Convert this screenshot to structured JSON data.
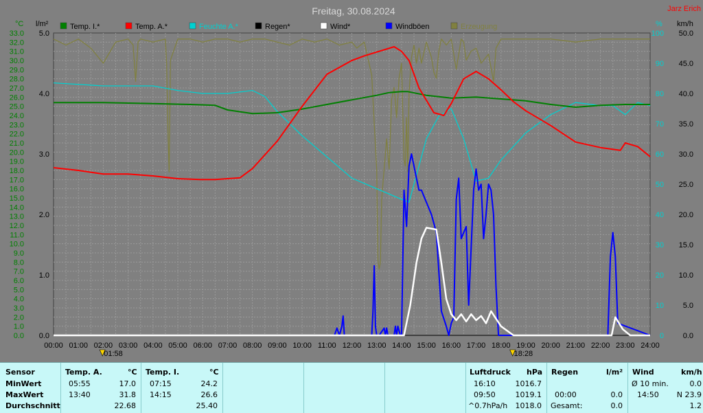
{
  "title": "Freitag, 30.08.2024",
  "author": "Jarz Erich",
  "axes": {
    "left1_unit": "°C",
    "left2_unit": "l/m²",
    "right1_unit": "%",
    "right2_unit": "km/h"
  },
  "markers": {
    "sunrise": "01:58",
    "sunset": "18:28"
  },
  "colors": {
    "temp_i": "#008000",
    "temp_a": "#ff0000",
    "feuchte": "#00d0d0",
    "regen": "#000000",
    "wind": "#ffffff",
    "windboeen": "#0000ff",
    "erzeugung": "#808040",
    "plot_bg": "#808080"
  },
  "chart_data": {
    "type": "line",
    "title": "Freitag, 30.08.2024",
    "xlabel": "",
    "x_ticks": [
      "00:00",
      "01:00",
      "02:00",
      "03:00",
      "04:00",
      "05:00",
      "06:00",
      "07:00",
      "08:00",
      "09:00",
      "10:00",
      "11:00",
      "12:00",
      "13:00",
      "14:00",
      "15:00",
      "16:00",
      "17:00",
      "18:00",
      "19:00",
      "20:00",
      "21:00",
      "22:00",
      "23:00",
      "24:00"
    ],
    "y_left_temp": {
      "label": "°C",
      "range": [
        0,
        33
      ],
      "ticks": [
        "0.0",
        "1.0",
        "2.0",
        "3.0",
        "4.0",
        "5.0",
        "6.0",
        "7.0",
        "8.0",
        "9.0",
        "10.0",
        "11.0",
        "12.0",
        "13.0",
        "14.0",
        "15.0",
        "16.0",
        "17.0",
        "18.0",
        "19.0",
        "20.0",
        "21.0",
        "22.0",
        "23.0",
        "24.0",
        "25.0",
        "26.0",
        "27.0",
        "28.0",
        "29.0",
        "30.0",
        "31.0",
        "32.0",
        "33.0"
      ]
    },
    "y_left_rain": {
      "label": "l/m²",
      "range": [
        0,
        5
      ],
      "ticks": [
        "0.0",
        "1.0",
        "2.0",
        "3.0",
        "4.0",
        "5.0"
      ]
    },
    "y_right_hum": {
      "label": "%",
      "range": [
        0,
        100
      ],
      "ticks": [
        "0",
        "10",
        "20",
        "30",
        "40",
        "50",
        "60",
        "70",
        "80",
        "90",
        "100"
      ]
    },
    "y_right_wind": {
      "label": "km/h",
      "range": [
        0,
        50
      ],
      "ticks": [
        "0.0",
        "5.0",
        "10.0",
        "15.0",
        "20.0",
        "25.0",
        "30.0",
        "35.0",
        "40.0",
        "45.0",
        "50.0"
      ]
    },
    "series": [
      {
        "name": "Temp. I.*",
        "axis": "temp",
        "x": [
          0,
          2,
          4,
          5.5,
          6.5,
          7,
          8,
          9,
          10,
          11,
          12,
          13,
          13.5,
          14,
          14.25,
          15,
          16,
          17,
          18,
          19,
          20,
          21,
          22,
          23,
          24
        ],
        "y": [
          25.4,
          25.4,
          25.3,
          25.2,
          25.1,
          24.6,
          24.2,
          24.3,
          24.7,
          25.2,
          25.7,
          26.2,
          26.5,
          26.6,
          26.6,
          26.2,
          25.9,
          26.0,
          25.8,
          25.6,
          25.2,
          24.9,
          25.1,
          25.2,
          25.2
        ]
      },
      {
        "name": "Temp. A.*",
        "axis": "temp",
        "x": [
          0,
          1,
          2,
          3,
          4,
          5,
          5.9,
          6.5,
          7.5,
          8,
          9,
          10,
          11,
          12,
          12.5,
          13.7,
          14,
          14.3,
          14.7,
          15.3,
          15.7,
          16,
          16.5,
          17,
          17.5,
          18,
          18.5,
          19,
          20,
          21,
          22,
          22.5,
          22.8,
          23,
          23.5,
          24
        ],
        "y": [
          18.3,
          18.0,
          17.6,
          17.6,
          17.4,
          17.1,
          17.0,
          17.0,
          17.2,
          18.2,
          21.2,
          25.0,
          28.5,
          30.0,
          30.5,
          31.5,
          31.0,
          30.0,
          27.0,
          24.3,
          24.0,
          25.3,
          28.0,
          28.8,
          28.0,
          26.8,
          25.5,
          24.5,
          22.9,
          21.1,
          20.5,
          20.3,
          20.2,
          21.0,
          20.6,
          19.5
        ]
      },
      {
        "name": "Feuchte A.*",
        "axis": "hum",
        "x": [
          0,
          2,
          3,
          4,
          5,
          6,
          7,
          8,
          8.5,
          9,
          10,
          11,
          12,
          13,
          14,
          14.3,
          15,
          15.5,
          16,
          16.5,
          17,
          17.5,
          18,
          19,
          20,
          21,
          22,
          22.5,
          23,
          23.5,
          24
        ],
        "y": [
          83.5,
          82.5,
          82.5,
          82.5,
          81,
          80,
          80,
          81,
          79,
          74,
          66,
          59,
          52,
          48.5,
          45,
          44,
          65,
          72.5,
          75,
          65,
          51,
          52,
          58,
          67,
          73,
          77,
          76,
          76,
          73,
          77,
          76
        ]
      },
      {
        "name": "Regen*",
        "axis": "rain",
        "x": [
          0,
          24
        ],
        "y": [
          0,
          0
        ]
      },
      {
        "name": "Wind*",
        "axis": "wind",
        "x": [
          0,
          14.1,
          14.35,
          14.6,
          14.8,
          15,
          15.4,
          15.6,
          15.8,
          16,
          16.2,
          16.4,
          16.6,
          16.8,
          17,
          17.2,
          17.4,
          17.6,
          18,
          18.5,
          22.45,
          22.6,
          22.9,
          23.2,
          24
        ],
        "y": [
          0,
          0,
          5,
          12,
          16,
          17.8,
          17.5,
          12,
          6,
          3.5,
          2.5,
          3.5,
          2.3,
          3.5,
          2.5,
          3.2,
          2,
          4,
          1.5,
          0,
          0,
          3,
          1,
          0,
          0
        ]
      },
      {
        "name": "Windböen",
        "axis": "wind",
        "x": [
          0,
          11.3,
          11.4,
          11.5,
          11.6,
          11.65,
          11.7,
          12.8,
          12.85,
          12.9,
          12.95,
          13.0,
          13.1,
          13.3,
          13.35,
          13.4,
          13.45,
          13.7,
          13.75,
          13.8,
          13.85,
          13.95,
          14,
          14.1,
          14.2,
          14.3,
          14.4,
          14.6,
          14.7,
          14.8,
          15,
          15.2,
          15.4,
          15.6,
          15.8,
          15.9,
          16,
          16.1,
          16.2,
          16.3,
          16.4,
          16.6,
          16.7,
          16.9,
          17,
          17.1,
          17.2,
          17.3,
          17.4,
          17.5,
          17.6,
          17.7,
          17.8,
          17.9,
          22.3,
          22.4,
          22.5,
          22.6,
          22.7,
          24
        ],
        "y": [
          0,
          0,
          1.2,
          0,
          1.5,
          3.2,
          0,
          0,
          4,
          11.5,
          1.5,
          0,
          0,
          1.2,
          0,
          1.2,
          0,
          0,
          1.5,
          0,
          1.5,
          0,
          0,
          24,
          18,
          28,
          30,
          26,
          24,
          24,
          22,
          20,
          17,
          4,
          1.5,
          0,
          2,
          3,
          22.5,
          26,
          16,
          18,
          5,
          24,
          27.5,
          24,
          25,
          16,
          20,
          25,
          24,
          20,
          8,
          0,
          0,
          13,
          17,
          13,
          2,
          0
        ]
      },
      {
        "name": "Erzeugung",
        "axis": "hum",
        "x": [
          0,
          0.5,
          1,
          1.5,
          2,
          2.5,
          3,
          3.2,
          3.3,
          3.4,
          3.5,
          4,
          4.5,
          4.55,
          4.6,
          4.65,
          4.7,
          5,
          5.5,
          6,
          6.5,
          7,
          7.5,
          8,
          8.5,
          9,
          9.5,
          10,
          10.5,
          11,
          11.5,
          12,
          12.2,
          12.5,
          12.8,
          12.9,
          13,
          13.05,
          13.1,
          13.15,
          13.2,
          13.4,
          13.5,
          13.6,
          13.7,
          13.8,
          13.9,
          14,
          14.1,
          14.15,
          14.2,
          14.25,
          14.3,
          14.4,
          14.5,
          14.6,
          14.7,
          14.8,
          15,
          15.2,
          15.3,
          15.4,
          15.5,
          15.6,
          15.8,
          16,
          16.2,
          16.4,
          16.5,
          16.6,
          16.8,
          17,
          17.2,
          17.5,
          17.7,
          17.8,
          18,
          18.5,
          19,
          20,
          21,
          22,
          23,
          24
        ],
        "y": [
          98,
          96,
          98,
          95,
          90,
          97,
          98,
          96,
          84,
          97,
          98,
          97,
          98,
          90,
          68,
          54,
          91,
          98,
          98,
          97,
          98,
          98,
          97,
          98,
          98,
          97,
          96,
          98,
          97,
          98,
          96,
          97,
          95,
          97,
          86,
          70,
          55,
          25,
          22,
          24,
          45,
          65,
          55,
          78,
          82,
          72,
          85,
          90,
          58,
          56,
          72,
          54,
          80,
          92,
          96,
          90,
          95,
          90,
          97,
          92,
          87,
          85,
          94,
          98,
          96,
          98,
          88,
          98,
          97,
          91,
          94,
          95,
          90,
          93,
          84,
          95,
          98,
          98,
          98,
          98,
          97,
          98,
          98,
          98
        ]
      }
    ]
  },
  "legend": [
    {
      "label": "Temp. I.*",
      "color": "#008000"
    },
    {
      "label": "Temp. A.*",
      "color": "#ff0000"
    },
    {
      "label": "Feuchte A.*",
      "color": "#00d0d0"
    },
    {
      "label": "Regen*",
      "color": "#000000"
    },
    {
      "label": "Wind*",
      "color": "#ffffff"
    },
    {
      "label": "Windböen",
      "color": "#0000ff"
    },
    {
      "label": "Erzeugung",
      "color": "#808040"
    }
  ],
  "table": {
    "sensor": {
      "header": "Sensor",
      "rows": [
        "MinWert",
        "MaxWert",
        "Durchschnitt"
      ]
    },
    "temp_a": {
      "header": "Temp. A.",
      "unit": "°C",
      "times": [
        "05:55",
        "13:40",
        ""
      ],
      "values": [
        "17.0",
        "31.8",
        "22.68"
      ]
    },
    "temp_i": {
      "header": "Temp. I.",
      "unit": "°C",
      "times": [
        "07:15",
        "14:15",
        ""
      ],
      "values": [
        "24.2",
        "26.6",
        "25.40"
      ]
    },
    "luftdruck": {
      "header": "Luftdruck",
      "unit": "hPa",
      "times": [
        "16:10",
        "09:50",
        "^0.7hPa/h"
      ],
      "values": [
        "1016.7",
        "1019.1",
        "1018.0"
      ]
    },
    "regen": {
      "header": "Regen",
      "unit": "l/m²",
      "times": [
        "",
        "00:00",
        "Gesamt:"
      ],
      "values": [
        "",
        "0.0",
        "0.0"
      ]
    },
    "wind": {
      "header": "Wind",
      "unit": "km/h",
      "times": [
        "Ø 10 min.",
        "14:50",
        ""
      ],
      "values": [
        "0.0",
        "N 23.9",
        "1.2"
      ]
    }
  }
}
